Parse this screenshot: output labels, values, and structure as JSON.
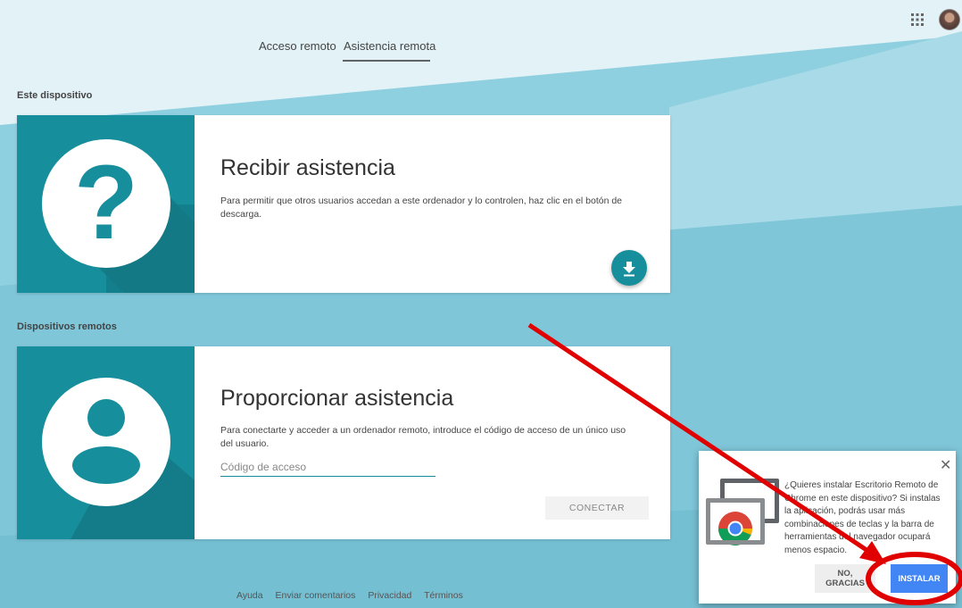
{
  "tabs": [
    {
      "label": "Acceso remoto",
      "active": false
    },
    {
      "label": "Asistencia remota",
      "active": true
    }
  ],
  "header_icons": {
    "apps": "apps-grid-icon",
    "account": "avatar"
  },
  "sections": {
    "this_device": "Este dispositivo",
    "remote_devices": "Dispositivos remotos"
  },
  "receive_card": {
    "title": "Recibir asistencia",
    "description": "Para permitir que otros usuarios accedan a este ordenador y lo controlen, haz clic en el botón de descarga.",
    "icon": "question-mark-icon",
    "action_icon": "download-icon"
  },
  "provide_card": {
    "title": "Proporcionar asistencia",
    "description": "Para conectarte y acceder a un ordenador remoto, introduce el código de acceso de un único uso del usuario.",
    "input_placeholder": "Código de acceso",
    "input_value": "",
    "button": "CONECTAR",
    "icon": "person-icon"
  },
  "footer": [
    "Ayuda",
    "Enviar comentarios",
    "Privacidad",
    "Términos"
  ],
  "install_prompt": {
    "text": "¿Quieres instalar Escritorio Remoto de Chrome en este dispositivo? Si instalas la aplicación, podrás usar más combinaciones de teclas y la barra de herramientas del navegador ocupará menos espacio.",
    "decline": "NO, GRACIAS",
    "accept": "INSTALAR",
    "close_icon": "close-icon"
  },
  "colors": {
    "accent": "#178e9c",
    "primary_button": "#4285f4",
    "annotation": "#e00000"
  }
}
